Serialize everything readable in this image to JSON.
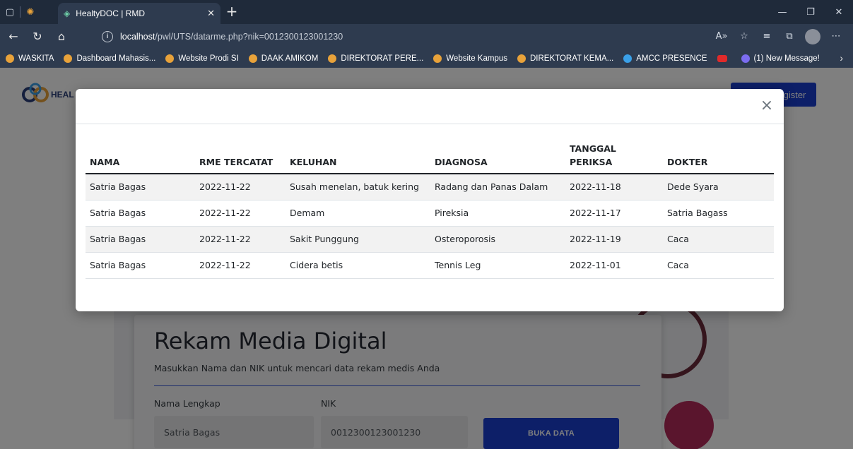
{
  "browser": {
    "tab_title": "HealtyDOC | RMD",
    "url_host": "localhost",
    "url_path": "/pwl/UTS/datarme.php?nik=0012300123001230",
    "bookmarks": [
      "WASKITA",
      "Dashboard Mahasis...",
      "Website Prodi SI",
      "DAAK AMIKOM",
      "DIREKTORAT PERE...",
      "Website Kampus",
      "DIREKTORAT KEMA...",
      "AMCC PRESENCE",
      "(1) New Message!"
    ]
  },
  "page": {
    "logo_text": "HEAL",
    "register_label": "gister",
    "card": {
      "title": "Rekam Media Digital",
      "subtitle": "Masukkan Nama dan NIK untuk mencari data rekam medis Anda",
      "name_label": "Nama Lengkap",
      "name_value": "Satria Bagas",
      "nik_label": "NIK",
      "nik_value": "0012300123001230",
      "submit_label": "BUKA DATA"
    }
  },
  "modal": {
    "close_glyph": "×",
    "headers": [
      "NAMA",
      "RME TERCATAT",
      "KELUHAN",
      "DIAGNOSA",
      "TANGGAL PERIKSA",
      "DOKTER"
    ],
    "rows": [
      [
        "Satria Bagas",
        "2022-11-22",
        "Susah menelan, batuk kering",
        "Radang dan Panas Dalam",
        "2022-11-18",
        "Dede Syara"
      ],
      [
        "Satria Bagas",
        "2022-11-22",
        "Demam",
        "Pireksia",
        "2022-11-17",
        "Satria Bagass"
      ],
      [
        "Satria Bagas",
        "2022-11-22",
        "Sakit Punggung",
        "Osteroporosis",
        "2022-11-19",
        "Caca"
      ],
      [
        "Satria Bagas",
        "2022-11-22",
        "Cidera betis",
        "Tennis Leg",
        "2022-11-01",
        "Caca"
      ]
    ]
  },
  "colors": {
    "primary": "#1a3fd1",
    "browser_dark": "#1f2a3a",
    "browser_bar": "#2e3b4f"
  }
}
